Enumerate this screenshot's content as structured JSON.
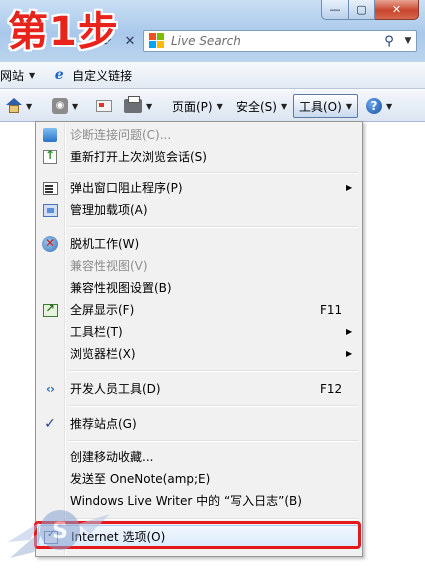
{
  "step_label": "第1步",
  "window_controls": {
    "minimize": "—",
    "maximize": "▢",
    "close": "✕"
  },
  "search": {
    "placeholder": "Live Search",
    "go_glyph": "⚲",
    "drop_glyph": "▼"
  },
  "favorites_bar": {
    "sites_label": "网站",
    "custom_links_label": "自定义链接",
    "caret": "▼"
  },
  "command_bar": {
    "caret": "▼",
    "rss_glyph": "◉",
    "page_label": "页面(P)",
    "safety_label": "安全(S)",
    "tools_label": "工具(O)",
    "help_glyph": "?"
  },
  "menu": {
    "items": [
      {
        "label": "诊断连接问题(C)...",
        "disabled": true,
        "icon": "diagnose-icon"
      },
      {
        "label": "重新打开上次浏览会话(S)",
        "icon": "reopen-session-icon"
      },
      {
        "label": "弹出窗口阻止程序(P)",
        "submenu": true,
        "icon": "popup-blocker-icon"
      },
      {
        "label": "管理加载项(A)",
        "icon": "manage-addons-icon"
      },
      {
        "label": "脱机工作(W)",
        "icon": "work-offline-icon"
      },
      {
        "label": "兼容性视图(V)",
        "disabled": true
      },
      {
        "label": "兼容性视图设置(B)"
      },
      {
        "label": "全屏显示(F)",
        "shortcut": "F11",
        "icon": "fullscreen-icon"
      },
      {
        "label": "工具栏(T)",
        "submenu": true
      },
      {
        "label": "浏览器栏(X)",
        "submenu": true
      },
      {
        "label": "开发人员工具(D)",
        "shortcut": "F12",
        "icon": "developer-tools-icon"
      },
      {
        "label": "推荐站点(G)",
        "checked": true,
        "icon": "checkmark-icon"
      },
      {
        "label": "创建移动收藏..."
      },
      {
        "label": "发送至 OneNote(amp;E)"
      },
      {
        "label": "Windows Live Writer 中的 “写入日志”(B)"
      },
      {
        "label": "Internet 选项(O)",
        "icon": "internet-options-icon",
        "highlighted": true
      }
    ],
    "submenu_arrow": "▶",
    "check_glyph": "✓"
  },
  "colors": {
    "highlight_box": "#e5191c",
    "step_label": "#e8231b",
    "disabled_text": "#8d8d8d"
  },
  "watermark_text": "S"
}
